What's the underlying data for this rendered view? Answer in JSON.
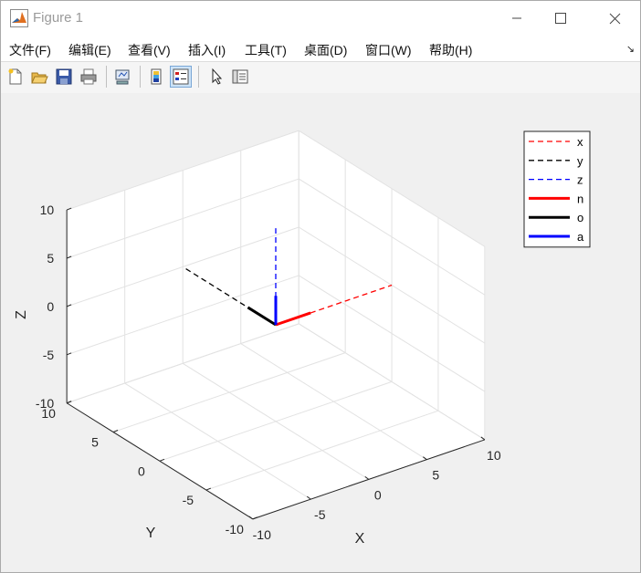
{
  "window": {
    "title": "Figure 1",
    "controls": {
      "minimize": "minimize",
      "maximize": "maximize",
      "close": "close"
    }
  },
  "menu": {
    "items": [
      {
        "label": "文件(F)"
      },
      {
        "label": "编辑(E)"
      },
      {
        "label": "查看(V)"
      },
      {
        "label": "插入(I)"
      },
      {
        "label": "工具(T)"
      },
      {
        "label": "桌面(D)"
      },
      {
        "label": "窗口(W)"
      },
      {
        "label": "帮助(H)"
      }
    ],
    "extra_icon": "dock-arrow-icon"
  },
  "toolbar": {
    "buttons": [
      {
        "icon": "new-figure-icon"
      },
      {
        "icon": "open-file-icon"
      },
      {
        "icon": "save-icon"
      },
      {
        "icon": "print-icon"
      },
      {
        "icon": "link-plot-icon"
      },
      {
        "icon": "colorbar-icon"
      },
      {
        "icon": "legend-icon",
        "active": true
      },
      {
        "icon": "pointer-icon"
      },
      {
        "icon": "property-inspector-icon"
      }
    ]
  },
  "chart_data": {
    "type": "line",
    "projection": "3d",
    "xlabel": "X",
    "ylabel": "Y",
    "zlabel": "Z",
    "xlim": [
      -10,
      10
    ],
    "ylim": [
      -10,
      10
    ],
    "zlim": [
      -10,
      10
    ],
    "xticks": [
      "-10",
      "-5",
      "0",
      "5",
      "10"
    ],
    "yticks": [
      "-10",
      "-5",
      "0",
      "5",
      "10"
    ],
    "zticks": [
      "-10",
      "-5",
      "0",
      "5",
      "10"
    ],
    "grid": true,
    "legend_position": "top-right",
    "series": [
      {
        "name": "x",
        "color": "#ff0000",
        "style": "dashed",
        "points": [
          [
            0,
            0,
            0
          ],
          [
            10,
            0,
            0
          ]
        ]
      },
      {
        "name": "y",
        "color": "#000000",
        "style": "dashed",
        "points": [
          [
            0,
            0,
            0
          ],
          [
            0,
            10,
            0
          ]
        ]
      },
      {
        "name": "z",
        "color": "#0000ff",
        "style": "dashed",
        "points": [
          [
            0,
            0,
            0
          ],
          [
            0,
            0,
            10
          ]
        ]
      },
      {
        "name": "n",
        "color": "#ff0000",
        "style": "solid",
        "points": [
          [
            0,
            0,
            0
          ],
          [
            3,
            0,
            0
          ]
        ]
      },
      {
        "name": "o",
        "color": "#000000",
        "style": "solid",
        "points": [
          [
            0,
            0,
            0
          ],
          [
            0,
            3,
            0
          ]
        ]
      },
      {
        "name": "a",
        "color": "#0000ff",
        "style": "solid",
        "points": [
          [
            0,
            0,
            0
          ],
          [
            0,
            0,
            3
          ]
        ]
      }
    ]
  }
}
